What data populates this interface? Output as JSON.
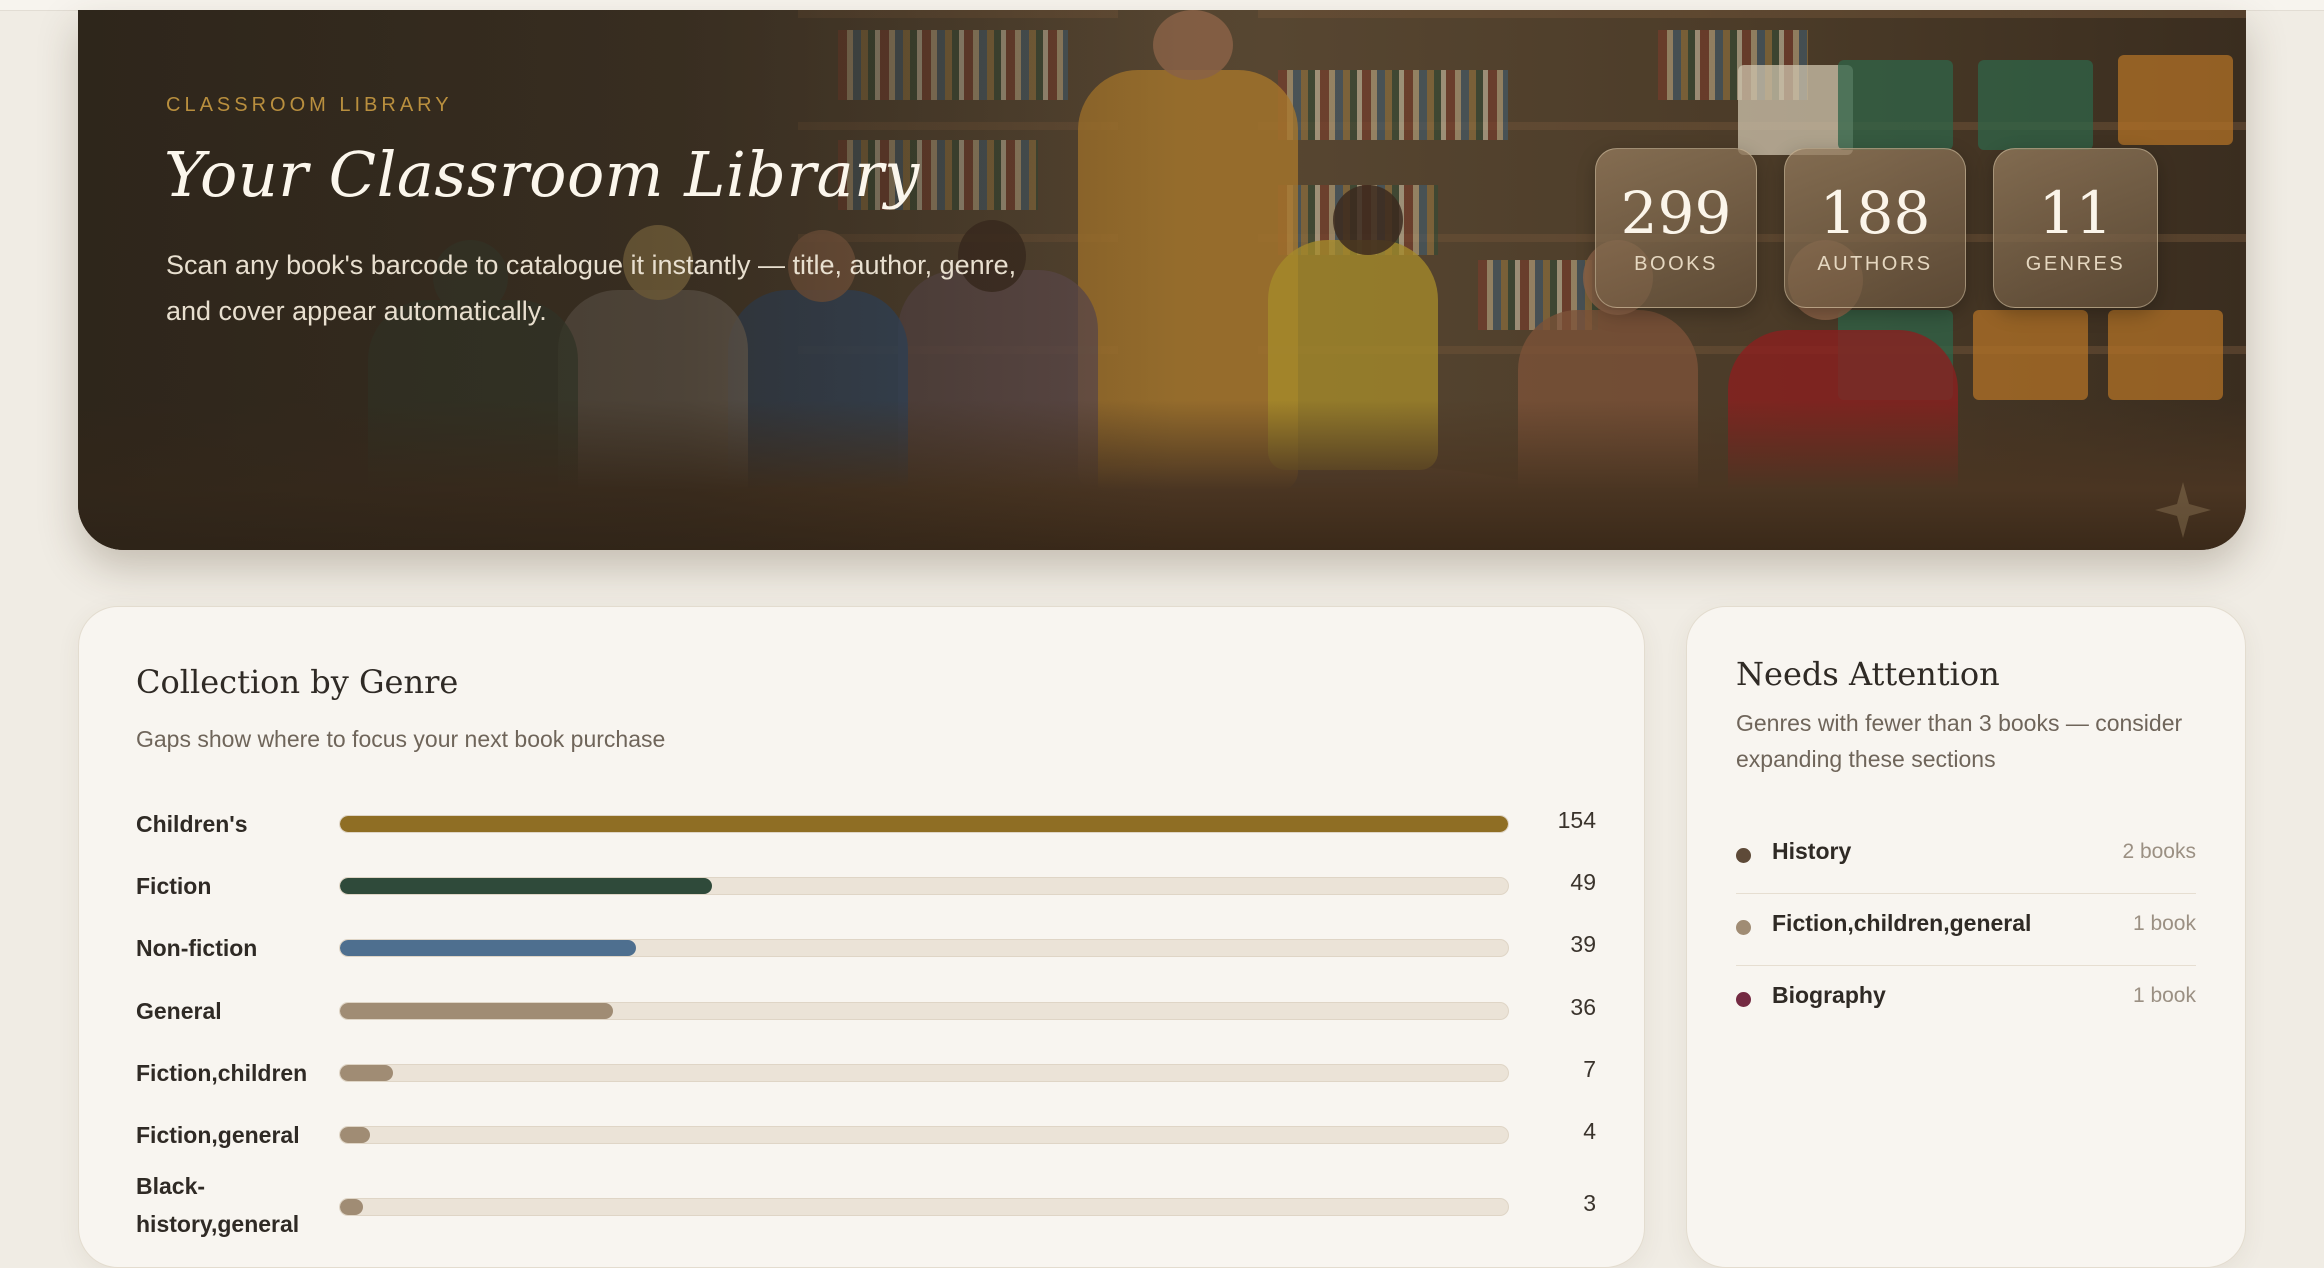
{
  "hero": {
    "eyebrow": "CLASSROOM LIBRARY",
    "title": "Your Classroom Library",
    "subtitle": "Scan any book's barcode to catalogue it instantly — title, author, genre, and cover appear automatically.",
    "stats": [
      {
        "value": "299",
        "label": "BOOKS"
      },
      {
        "value": "188",
        "label": "AUTHORS"
      },
      {
        "value": "11",
        "label": "GENRES"
      }
    ]
  },
  "genre_card": {
    "title": "Collection by Genre",
    "subtitle": "Gaps show where to focus your next book purchase",
    "colors": {
      "gold": "#8f6e24",
      "green": "#2f4a3a",
      "blue": "#4e6f8f",
      "taupe": "#a08c74"
    }
  },
  "chart_data": {
    "type": "bar",
    "orientation": "horizontal",
    "title": "Collection by Genre",
    "categories": [
      "Children's",
      "Fiction",
      "Non-fiction",
      "General",
      "Fiction,children",
      "Fiction,general",
      "Black-history,general"
    ],
    "values": [
      154,
      49,
      39,
      36,
      7,
      4,
      3
    ],
    "colors": [
      "#8f6e24",
      "#2f4a3a",
      "#4e6f8f",
      "#a08c74",
      "#a08c74",
      "#a08c74",
      "#a08c74"
    ],
    "xlim": [
      0,
      154
    ]
  },
  "attention_card": {
    "title": "Needs Attention",
    "subtitle": "Genres with fewer than 3 books — consider expanding these sections",
    "items": [
      {
        "name": "History",
        "count": "2 books",
        "color": "#5e4a38"
      },
      {
        "name": "Fiction,children,general",
        "count": "1 book",
        "color": "#a08c74"
      },
      {
        "name": "Biography",
        "count": "1 book",
        "color": "#742a42"
      }
    ]
  }
}
